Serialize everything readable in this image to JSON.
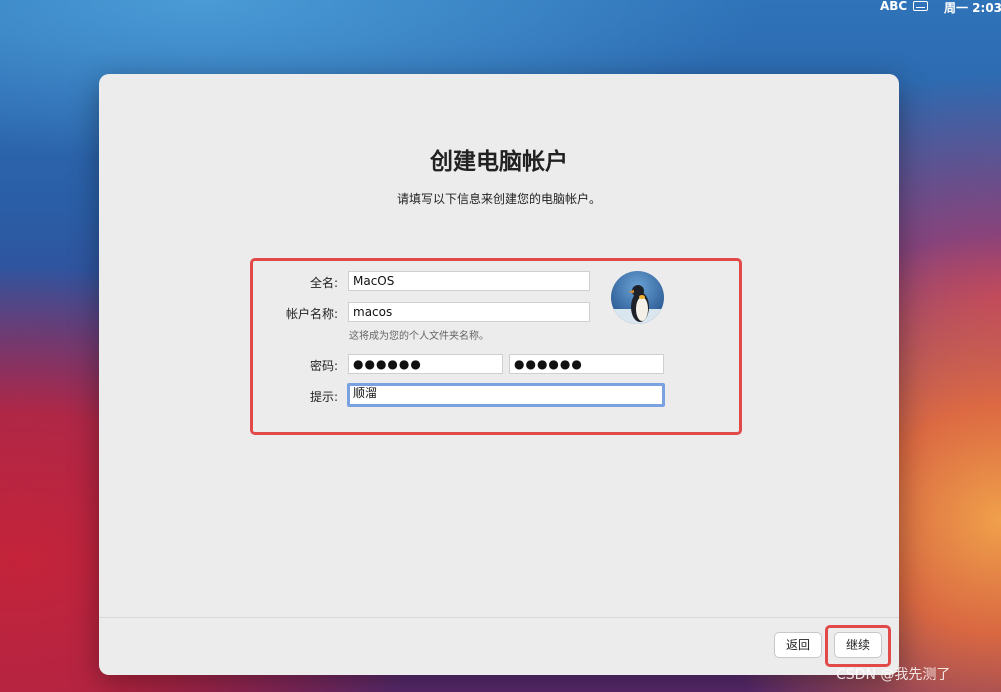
{
  "menubar": {
    "input_source": "ABC",
    "clock": "周一 2:03",
    "keyboard_icon": "keyboard-icon"
  },
  "dialog": {
    "title": "创建电脑帐户",
    "subtitle": "请填写以下信息来创建您的电脑帐户。",
    "form": {
      "full_name_label": "全名:",
      "full_name_value": "MacOS",
      "account_name_label": "帐户名称:",
      "account_name_value": "macos",
      "account_name_hint": "这将成为您的个人文件夹名称。",
      "password_label": "密码:",
      "password_value": "●●●●●●",
      "password_verify_value": "●●●●●●",
      "hint_label": "提示:",
      "hint_value": "顺溜",
      "avatar": "penguin-avatar"
    },
    "buttons": {
      "back": "返回",
      "continue": "继续"
    }
  },
  "watermark": "CSDN @我先测了",
  "colors": {
    "highlight": "#e24a4a",
    "focus_ring": "#7aa2e0",
    "panel_bg": "#ececec"
  }
}
